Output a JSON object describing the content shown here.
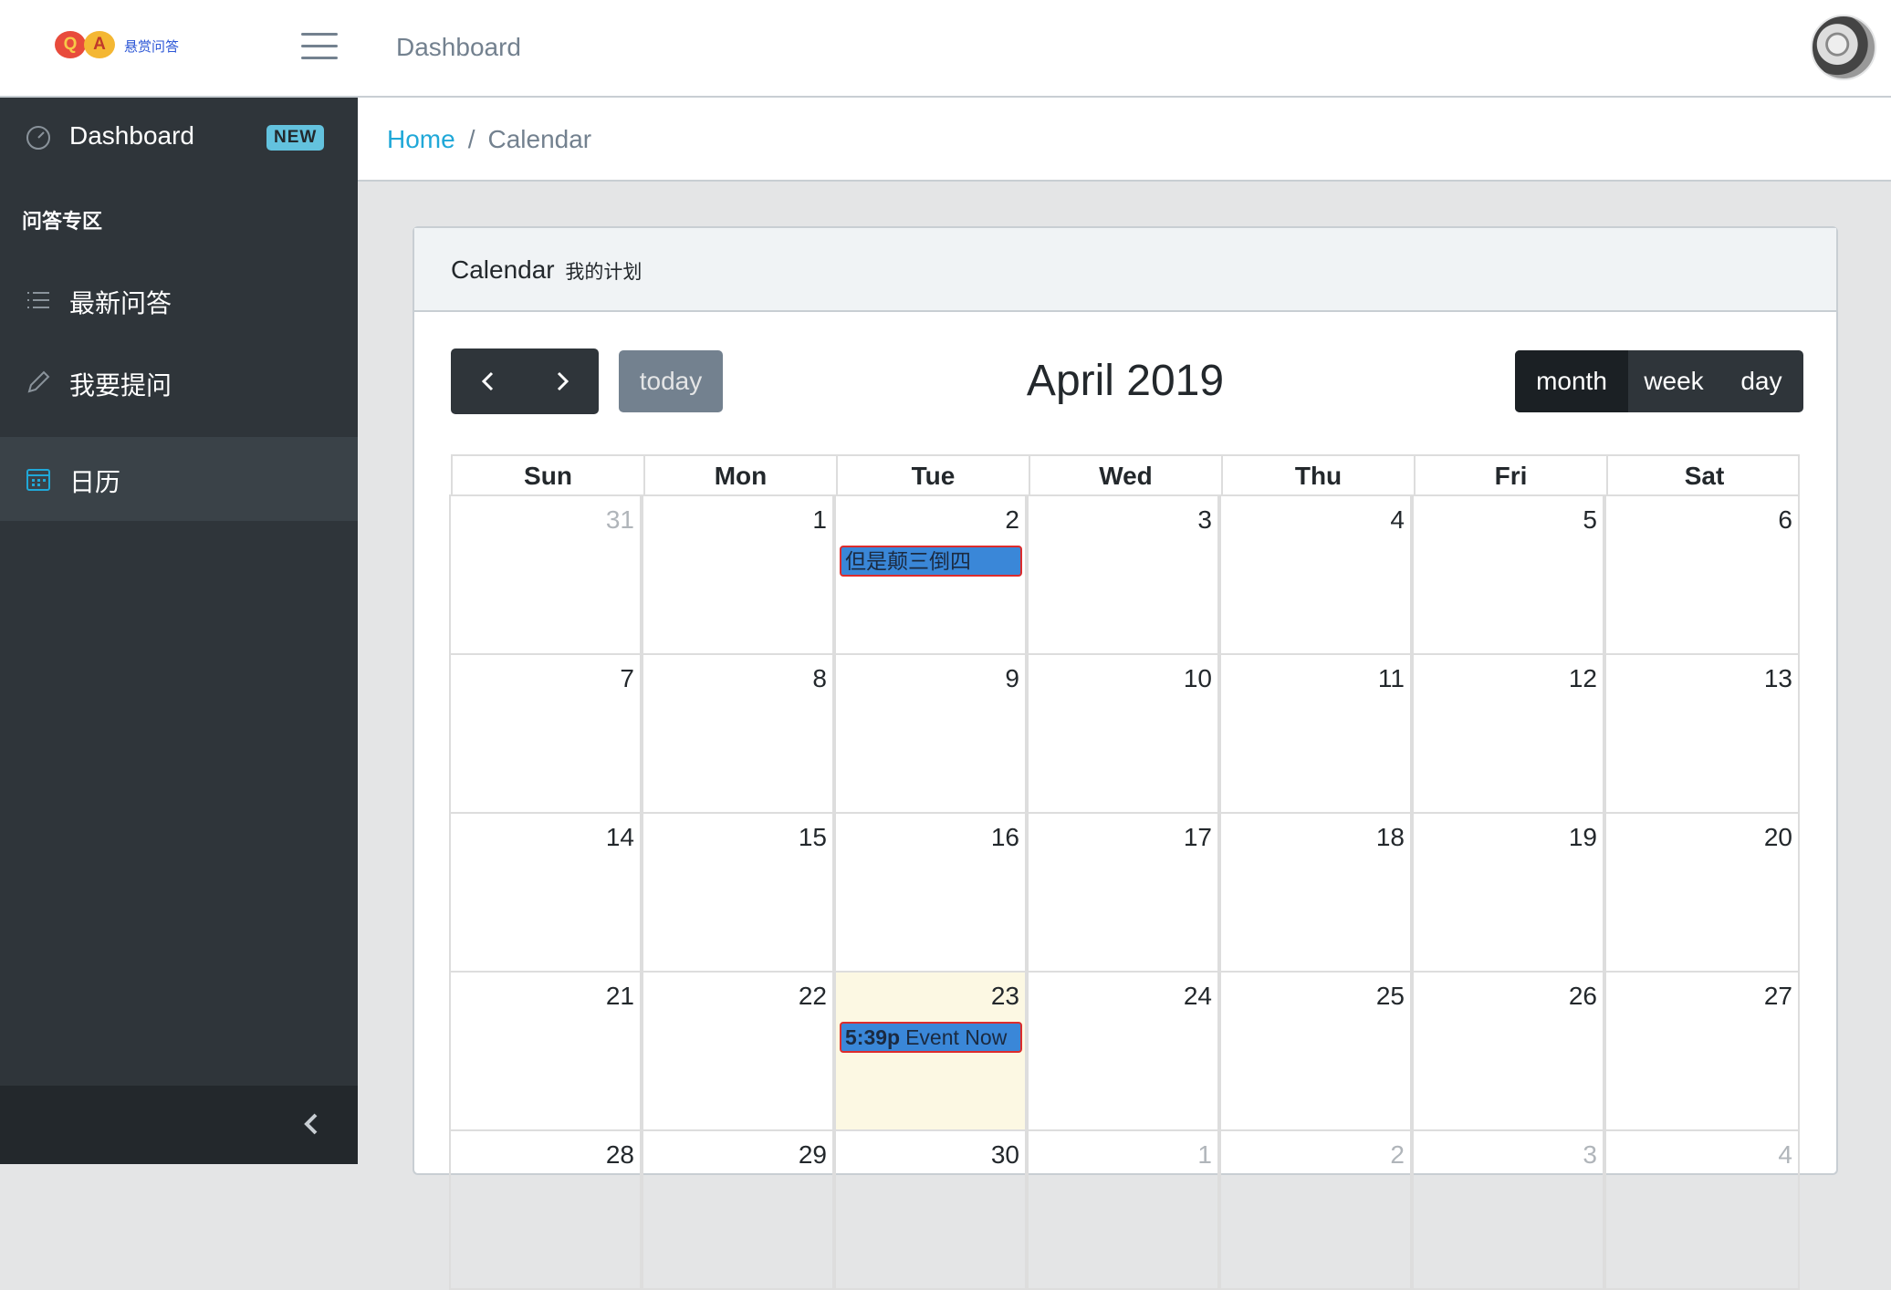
{
  "brand": {
    "q": "Q",
    "a": "A",
    "text": "悬赏问答"
  },
  "header": {
    "title": "Dashboard"
  },
  "sidebar": {
    "dashboard_label": "Dashboard",
    "dashboard_badge": "NEW",
    "section_title": "问答专区",
    "items": [
      {
        "label": "最新问答"
      },
      {
        "label": "我要提问"
      },
      {
        "label": "日历"
      }
    ]
  },
  "breadcrumb": {
    "home": "Home",
    "separator": "/",
    "current": "Calendar"
  },
  "card": {
    "title": "Calendar",
    "subtitle": "我的计划"
  },
  "calendar": {
    "today_label": "today",
    "title": "April 2019",
    "views": {
      "month": "month",
      "week": "week",
      "day": "day",
      "active": "month"
    },
    "weekdays": [
      "Sun",
      "Mon",
      "Tue",
      "Wed",
      "Thu",
      "Fri",
      "Sat"
    ],
    "weeks": [
      [
        "31",
        "1",
        "2",
        "3",
        "4",
        "5",
        "6"
      ],
      [
        "7",
        "8",
        "9",
        "10",
        "11",
        "12",
        "13"
      ],
      [
        "14",
        "15",
        "16",
        "17",
        "18",
        "19",
        "20"
      ],
      [
        "21",
        "22",
        "23",
        "24",
        "25",
        "26",
        "27"
      ],
      [
        "28",
        "29",
        "30",
        "1",
        "2",
        "3",
        "4"
      ]
    ],
    "today_day": "23",
    "events": [
      {
        "day": "2",
        "time": "",
        "title": "但是颠三倒四"
      },
      {
        "day": "23",
        "time": "5:39p",
        "title": "Event Now"
      }
    ]
  },
  "colors": {
    "accent": "#20a8d8",
    "sidebar": "#2f353a",
    "event": "#3a87d8",
    "event_border": "#dd2c2c",
    "today_bg": "#fcf8e3"
  }
}
